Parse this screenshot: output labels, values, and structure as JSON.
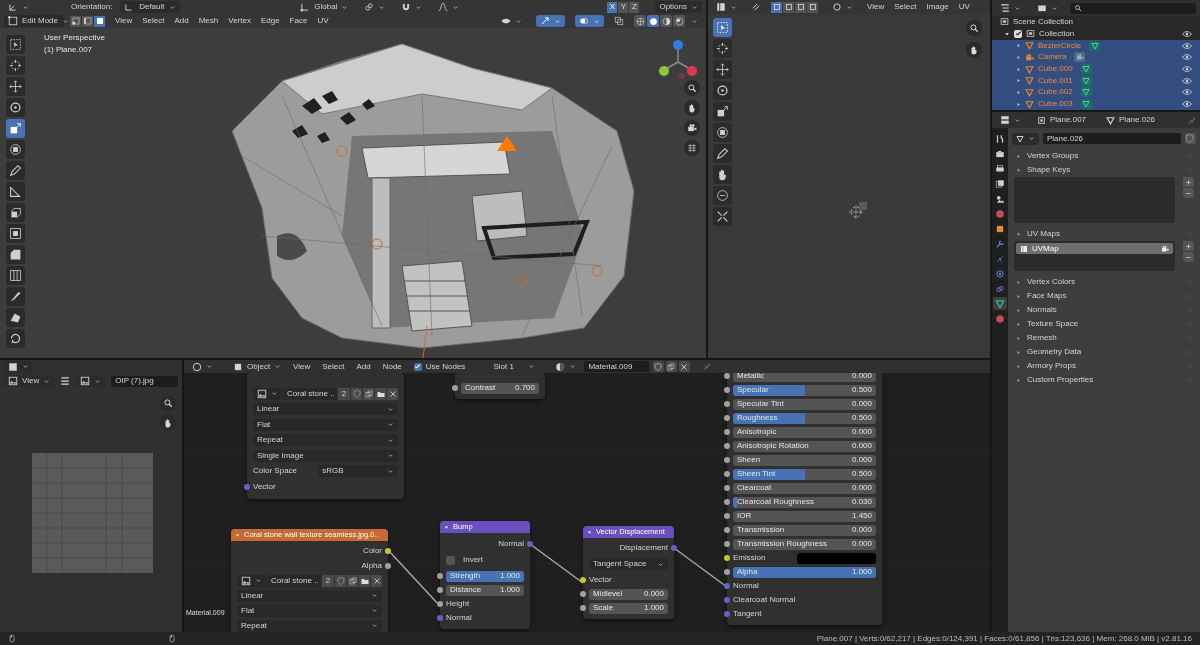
{
  "viewport": {
    "header": {
      "orientation_label": "Orientation:",
      "orientation": "Default",
      "transform_orientation": "Global",
      "axes": [
        {
          "label": "X",
          "selected": true
        },
        {
          "label": "Y",
          "selected": false
        },
        {
          "label": "Z",
          "selected": false
        }
      ],
      "options": "Options"
    },
    "mode": "Edit Mode",
    "select_modes": [
      {
        "kind": "vertex",
        "selected": false
      },
      {
        "kind": "edge",
        "selected": false
      },
      {
        "kind": "face",
        "selected": true
      }
    ],
    "menu": [
      "View",
      "Select",
      "Add",
      "Mesh",
      "Vertex",
      "Edge",
      "Face",
      "UV"
    ],
    "shading": [
      {
        "kind": "wireframe",
        "selected": false
      },
      {
        "kind": "solid",
        "selected": true
      },
      {
        "kind": "material",
        "selected": false
      },
      {
        "kind": "rendered",
        "selected": false
      }
    ],
    "info": [
      "User Perspective",
      "(1) Plane.007"
    ],
    "tools": [
      {
        "kind": "select",
        "selected": false
      },
      {
        "kind": "cursor",
        "selected": false
      },
      {
        "kind": "move",
        "selected": false
      },
      {
        "kind": "rotate",
        "selected": false
      },
      {
        "kind": "scale",
        "selected": true
      },
      {
        "kind": "transform",
        "selected": false
      },
      {
        "kind": "annotate",
        "selected": false
      },
      {
        "kind": "measure",
        "selected": false
      },
      {
        "kind": "extrude",
        "selected": false
      },
      {
        "kind": "inset",
        "selected": false
      },
      {
        "kind": "bevel",
        "selected": false
      },
      {
        "kind": "loopcut",
        "selected": false
      },
      {
        "kind": "knife",
        "selected": false
      },
      {
        "kind": "polybuild",
        "selected": false
      },
      {
        "kind": "spin",
        "selected": false
      }
    ]
  },
  "uv_editor": {
    "menu": [
      "View",
      "Select",
      "Image",
      "UV"
    ],
    "tools": [
      {
        "kind": "select",
        "selected": true
      },
      {
        "kind": "cursor",
        "selected": false
      },
      {
        "kind": "move",
        "selected": false
      },
      {
        "kind": "rotate",
        "selected": false
      },
      {
        "kind": "scale",
        "selected": false
      },
      {
        "kind": "transform",
        "selected": false
      },
      {
        "kind": "annotate",
        "selected": false
      },
      {
        "kind": "grab",
        "selected": false
      },
      {
        "kind": "relax",
        "selected": false
      },
      {
        "kind": "pinch",
        "selected": false
      }
    ]
  },
  "outliner": {
    "root": "Scene Collection",
    "collection": {
      "label": "Collection",
      "checked": true,
      "expanded": true
    },
    "objects": [
      {
        "label": "BezierCircle",
        "kind": "mesh",
        "selected": true
      },
      {
        "label": "Camera",
        "kind": "camera",
        "selected": true
      },
      {
        "label": "Cube.000",
        "kind": "mesh",
        "selected": true
      },
      {
        "label": "Cube.001",
        "kind": "mesh",
        "selected": true
      },
      {
        "label": "Cube.002",
        "kind": "mesh",
        "selected": true
      },
      {
        "label": "Cube.003",
        "kind": "mesh",
        "selected": true
      }
    ]
  },
  "properties": {
    "object": "Plane.007",
    "mesh": "Plane.026",
    "datablock": "Plane.026",
    "tabs": [
      {
        "kind": "tool",
        "selected": false
      },
      {
        "kind": "render",
        "selected": false
      },
      {
        "kind": "output",
        "selected": false
      },
      {
        "kind": "view_layer",
        "selected": false
      },
      {
        "kind": "scene",
        "selected": false
      },
      {
        "kind": "world",
        "selected": false
      },
      {
        "kind": "object",
        "selected": false
      },
      {
        "kind": "modifiers",
        "selected": false
      },
      {
        "kind": "particles",
        "selected": false
      },
      {
        "kind": "physics",
        "selected": false
      },
      {
        "kind": "constraints",
        "selected": false
      },
      {
        "kind": "data",
        "selected": true
      },
      {
        "kind": "material",
        "selected": false
      }
    ],
    "panels": [
      {
        "label": "Vertex Groups",
        "expanded": false
      },
      {
        "label": "Shape Keys",
        "expanded": true
      },
      {
        "label": "UV Maps",
        "expanded": true,
        "items": [
          "UVMap"
        ]
      },
      {
        "label": "Vertex Colors",
        "expanded": false
      },
      {
        "label": "Face Maps",
        "expanded": false
      },
      {
        "label": "Normals",
        "expanded": false
      },
      {
        "label": "Texture Space",
        "expanded": false
      },
      {
        "label": "Remesh",
        "expanded": false
      },
      {
        "label": "Geometry Data",
        "expanded": false
      },
      {
        "label": "Armory Props",
        "expanded": false
      },
      {
        "label": "Custom Properties",
        "expanded": false
      }
    ]
  },
  "image_editor": {
    "view_menu": "View",
    "image": "OIP (7).jpg"
  },
  "node_editor": {
    "header": {
      "mode": "Object",
      "menu": [
        "View",
        "Select",
        "Add",
        "Node"
      ],
      "use_nodes": {
        "label": "Use Nodes",
        "checked": true
      },
      "slot": "Slot 1",
      "material": "Material.009"
    },
    "frame_label": "Material.009",
    "nodes": [
      {
        "rows": [
          {
            "kind": "image",
            "name": "Coral stone ..",
            "users": "2"
          },
          {
            "kind": "dropdown",
            "value": "Linear"
          },
          {
            "kind": "dropdown",
            "value": "Flat"
          },
          {
            "kind": "dropdown",
            "value": "Repeat"
          },
          {
            "kind": "dropdown",
            "value": "Single Image"
          },
          {
            "kind": "dropdown",
            "label": "Color Space",
            "value": "sRGB"
          },
          {
            "kind": "input",
            "label": "Vector",
            "socket": {
              "color": "#6363c7"
            }
          }
        ]
      },
      {
        "rows": [
          {
            "kind": "number",
            "label": "Contrast",
            "value": "0.700",
            "socket": {
              "color": "#a1a1a1"
            }
          }
        ]
      },
      {
        "title": "Coral stone wall texture seamless.jpg.0..",
        "header": {
          "color": "#c46a32"
        },
        "rows": [
          {
            "kind": "output",
            "label": "Color",
            "socket": {
              "color": "#c7c729"
            }
          },
          {
            "kind": "output",
            "label": "Alpha",
            "socket": {
              "color": "#a1a1a1"
            }
          },
          {
            "kind": "image",
            "name": "Coral stone ..",
            "users": "2"
          },
          {
            "kind": "dropdown",
            "value": "Linear"
          },
          {
            "kind": "dropdown",
            "value": "Flat"
          },
          {
            "kind": "dropdown",
            "value": "Repeat"
          }
        ]
      },
      {
        "title": "Bump",
        "header": {
          "color": "#6a4fbf"
        },
        "rows": [
          {
            "kind": "output",
            "label": "Normal",
            "socket": {
              "color": "#6363c7"
            }
          },
          {
            "kind": "checkbox",
            "label": "Invert",
            "checked": false
          },
          {
            "kind": "slider",
            "label": "Strength",
            "value": "1.000",
            "level": 1,
            "socket": {
              "color": "#a1a1a1"
            }
          },
          {
            "kind": "number",
            "label": "Distance",
            "value": "1.000",
            "socket": {
              "color": "#a1a1a1"
            }
          },
          {
            "kind": "input",
            "label": "Height",
            "socket": {
              "color": "#a1a1a1"
            }
          },
          {
            "kind": "input",
            "label": "Normal",
            "socket": {
              "color": "#6363c7"
            }
          }
        ]
      },
      {
        "title": "Vector Displacement",
        "header": {
          "color": "#6a4fbf"
        },
        "rows": [
          {
            "kind": "output",
            "label": "Displacement",
            "socket": {
              "color": "#6363c7"
            }
          },
          {
            "kind": "dropdown",
            "value": "Tangent Space"
          },
          {
            "kind": "input",
            "label": "Vector",
            "socket": {
              "color": "#c7c729"
            }
          },
          {
            "kind": "number",
            "label": "Midlevel",
            "value": "0.000",
            "socket": {
              "color": "#a1a1a1"
            }
          },
          {
            "kind": "number",
            "label": "Scale",
            "value": "1.000",
            "socket": {
              "color": "#a1a1a1"
            }
          }
        ]
      },
      {
        "rows": [
          {
            "kind": "slider",
            "label": "Metallic",
            "value": "0.000",
            "level": 0,
            "socket": {
              "color": "#a1a1a1"
            }
          },
          {
            "kind": "slider",
            "label": "Specular",
            "value": "0.500",
            "level": 0.5,
            "socket": {
              "color": "#a1a1a1"
            }
          },
          {
            "kind": "slider",
            "label": "Specular Tint",
            "value": "0.000",
            "level": 0,
            "socket": {
              "color": "#a1a1a1"
            }
          },
          {
            "kind": "slider",
            "label": "Roughness",
            "value": "0.500",
            "level": 0.5,
            "socket": {
              "color": "#a1a1a1"
            }
          },
          {
            "kind": "slider",
            "label": "Anisotropic",
            "value": "0.000",
            "level": 0,
            "socket": {
              "color": "#a1a1a1"
            }
          },
          {
            "kind": "slider",
            "label": "Anisotropic Rotation",
            "value": "0.000",
            "level": 0,
            "socket": {
              "color": "#a1a1a1"
            }
          },
          {
            "kind": "slider",
            "label": "Sheen",
            "value": "0.000",
            "level": 0,
            "socket": {
              "color": "#a1a1a1"
            }
          },
          {
            "kind": "slider",
            "label": "Sheen Tint",
            "value": "0.500",
            "level": 0.5,
            "socket": {
              "color": "#a1a1a1"
            }
          },
          {
            "kind": "slider",
            "label": "Clearcoat",
            "value": "0.000",
            "level": 0,
            "socket": {
              "color": "#a1a1a1"
            }
          },
          {
            "kind": "slider",
            "label": "Clearcoat Roughness",
            "value": "0.030",
            "level": 0.03,
            "socket": {
              "color": "#a1a1a1"
            }
          },
          {
            "kind": "number",
            "label": "IOR",
            "value": "1.450",
            "socket": {
              "color": "#a1a1a1"
            }
          },
          {
            "kind": "slider",
            "label": "Transmission",
            "value": "0.000",
            "level": 0,
            "socket": {
              "color": "#a1a1a1"
            }
          },
          {
            "kind": "slider",
            "label": "Transmission Roughness",
            "value": "0.000",
            "level": 0,
            "socket": {
              "color": "#a1a1a1"
            }
          },
          {
            "kind": "color",
            "label": "Emission",
            "color": "#000000",
            "socket": {
              "color": "#c7c729"
            }
          },
          {
            "kind": "slider",
            "label": "Alpha",
            "value": "1.000",
            "level": 1,
            "socket": {
              "color": "#a1a1a1"
            }
          },
          {
            "kind": "input",
            "label": "Normal",
            "socket": {
              "color": "#6363c7"
            }
          },
          {
            "kind": "input",
            "label": "Clearcoat Normal",
            "socket": {
              "color": "#6363c7"
            }
          },
          {
            "kind": "input",
            "label": "Tangent",
            "socket": {
              "color": "#6363c7"
            }
          }
        ]
      }
    ]
  },
  "status_bar": "Plane.007 | Verts:0/62,217 | Edges:0/124,391 | Faces:0/61,856 | Tris:123,636 | Mem: 268.0 MiB | v2.81.16"
}
